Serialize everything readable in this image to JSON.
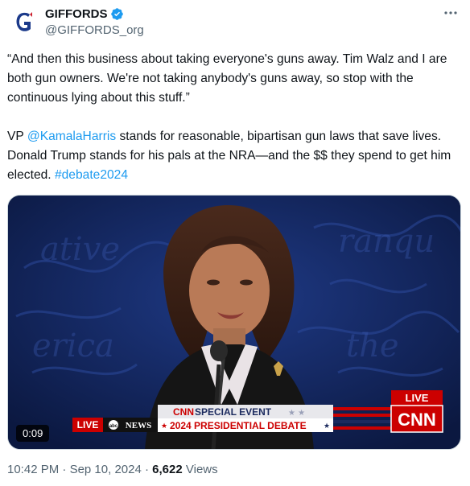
{
  "author": {
    "name": "GIFFORDS",
    "handle": "@GIFFORDS_org",
    "avatar_letter": "G",
    "verified": true
  },
  "more_icon": "more-horizontal-icon",
  "tweet": {
    "quote": "“And then this business about taking everyone's guns away. Tim Walz and I are both gun owners. We're not taking anybody's guns away, so stop with the continuous lying about this stuff.”",
    "body_prefix": "VP ",
    "mention": "@KamalaHarris",
    "body_middle": " stands for reasonable, bipartisan gun laws that save lives. Donald Trump stands for his pals at the NRA—and the $$ they spend to get him elected. ",
    "hashtag": "#debate2024"
  },
  "video": {
    "duration": "0:09",
    "chyron": {
      "live_left": "LIVE",
      "network_left": "NEWS",
      "brand": "CNN",
      "special_event": "SPECIAL EVENT",
      "debate_title": "2024 PRESIDENTIAL DEBATE",
      "live_right": "LIVE",
      "cnn_logo": "CNN"
    }
  },
  "meta": {
    "time": "10:42 PM",
    "separator": "·",
    "date": "Sep 10, 2024",
    "views_count": "6,622",
    "views_label": "Views"
  },
  "colors": {
    "link": "#1d9bf0",
    "verified": "#1d9bf0",
    "secondary_text": "#536471",
    "cnn_red": "#cc0000",
    "debate_navy": "#1b2a5e"
  }
}
